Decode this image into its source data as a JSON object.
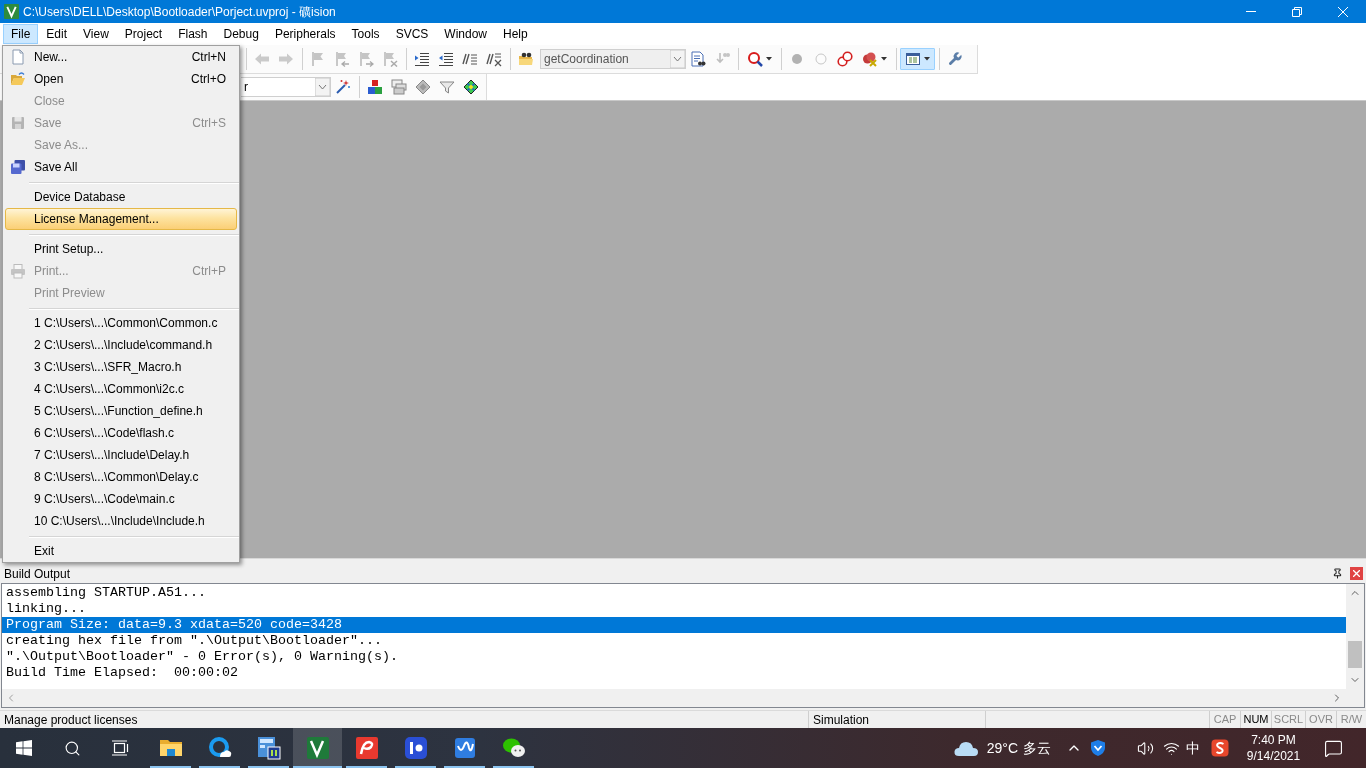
{
  "window": {
    "title": "C:\\Users\\DELL\\Desktop\\Bootloader\\Porject.uvproj - 礦ision"
  },
  "menu_bar": [
    {
      "label": "File",
      "selected": true
    },
    {
      "label": "Edit",
      "selected": false
    },
    {
      "label": "View",
      "selected": false
    },
    {
      "label": "Project",
      "selected": false
    },
    {
      "label": "Flash",
      "selected": false
    },
    {
      "label": "Debug",
      "selected": false
    },
    {
      "label": "Peripherals",
      "selected": false
    },
    {
      "label": "Tools",
      "selected": false
    },
    {
      "label": "SVCS",
      "selected": false
    },
    {
      "label": "Window",
      "selected": false
    },
    {
      "label": "Help",
      "selected": false
    }
  ],
  "toolbar_1": [
    {
      "kind": "separator"
    },
    {
      "kind": "button",
      "disabled": true,
      "pressed": false
    },
    {
      "kind": "button",
      "disabled": true,
      "pressed": false
    },
    {
      "kind": "separator"
    },
    {
      "kind": "button",
      "disabled": true,
      "pressed": false
    },
    {
      "kind": "button",
      "disabled": true,
      "pressed": false
    },
    {
      "kind": "button",
      "disabled": true,
      "pressed": false
    },
    {
      "kind": "button",
      "disabled": true,
      "pressed": false
    },
    {
      "kind": "separator"
    },
    {
      "kind": "button",
      "disabled": false,
      "pressed": false
    },
    {
      "kind": "button",
      "disabled": false,
      "pressed": false
    },
    {
      "kind": "button",
      "disabled": false,
      "pressed": false
    },
    {
      "kind": "button",
      "disabled": false,
      "pressed": false
    },
    {
      "kind": "separator"
    },
    {
      "kind": "button",
      "disabled": false,
      "pressed": false
    },
    {
      "kind": "combo",
      "value": "getCoordination",
      "disabled": true
    },
    {
      "kind": "button",
      "disabled": false,
      "pressed": false
    },
    {
      "kind": "button",
      "disabled": true,
      "pressed": false
    },
    {
      "kind": "separator"
    },
    {
      "kind": "split",
      "disabled": false,
      "pressed": false
    },
    {
      "kind": "separator"
    },
    {
      "kind": "button",
      "disabled": true,
      "pressed": false
    },
    {
      "kind": "button",
      "disabled": true,
      "pressed": false
    },
    {
      "kind": "button",
      "disabled": false,
      "pressed": false
    },
    {
      "kind": "split",
      "disabled": false,
      "pressed": false
    },
    {
      "kind": "separator"
    },
    {
      "kind": "split",
      "disabled": false,
      "pressed": true
    },
    {
      "kind": "separator"
    },
    {
      "kind": "button",
      "disabled": false,
      "pressed": false
    }
  ],
  "toolbar_2": [
    {
      "kind": "combo",
      "value": "r",
      "disabled": false
    },
    {
      "kind": "button"
    },
    {
      "kind": "separator"
    },
    {
      "kind": "button"
    },
    {
      "kind": "button"
    },
    {
      "kind": "button"
    },
    {
      "kind": "button"
    },
    {
      "kind": "button"
    }
  ],
  "file_menu": [
    {
      "kind": "item",
      "label": "New...",
      "shortcut": "Ctrl+N",
      "disabled": false,
      "selected": false
    },
    {
      "kind": "item",
      "label": "Open",
      "shortcut": "Ctrl+O",
      "disabled": false,
      "selected": false
    },
    {
      "kind": "item",
      "label": "Close",
      "disabled": true,
      "selected": false
    },
    {
      "kind": "item",
      "label": "Save",
      "shortcut": "Ctrl+S",
      "disabled": true,
      "selected": false
    },
    {
      "kind": "item",
      "label": "Save As...",
      "disabled": true,
      "selected": false
    },
    {
      "kind": "item",
      "label": "Save All",
      "disabled": false,
      "selected": false
    },
    {
      "kind": "separator"
    },
    {
      "kind": "item",
      "label": "Device Database",
      "disabled": false,
      "selected": false
    },
    {
      "kind": "item",
      "label": "License Management...",
      "disabled": false,
      "selected": true
    },
    {
      "kind": "separator"
    },
    {
      "kind": "item",
      "label": "Print Setup...",
      "disabled": false,
      "selected": false
    },
    {
      "kind": "item",
      "label": "Print...",
      "shortcut": "Ctrl+P",
      "disabled": true,
      "selected": false
    },
    {
      "kind": "item",
      "label": "Print Preview",
      "disabled": true,
      "selected": false
    },
    {
      "kind": "separator"
    },
    {
      "kind": "item",
      "label": "1 C:\\Users\\...\\Common\\Common.c",
      "disabled": false,
      "selected": false
    },
    {
      "kind": "item",
      "label": "2 C:\\Users\\...\\Include\\command.h",
      "disabled": false,
      "selected": false
    },
    {
      "kind": "item",
      "label": "3 C:\\Users\\...\\SFR_Macro.h",
      "disabled": false,
      "selected": false
    },
    {
      "kind": "item",
      "label": "4 C:\\Users\\...\\Common\\i2c.c",
      "disabled": false,
      "selected": false
    },
    {
      "kind": "item",
      "label": "5 C:\\Users\\...\\Function_define.h",
      "disabled": false,
      "selected": false
    },
    {
      "kind": "item",
      "label": "6 C:\\Users\\...\\Code\\flash.c",
      "disabled": false,
      "selected": false
    },
    {
      "kind": "item",
      "label": "7 C:\\Users\\...\\Include\\Delay.h",
      "disabled": false,
      "selected": false
    },
    {
      "kind": "item",
      "label": "8 C:\\Users\\...\\Common\\Delay.c",
      "disabled": false,
      "selected": false
    },
    {
      "kind": "item",
      "label": "9 C:\\Users\\...\\Code\\main.c",
      "disabled": false,
      "selected": false
    },
    {
      "kind": "item",
      "label": "10 C:\\Users\\...\\Include\\Include.h",
      "disabled": false,
      "selected": false
    },
    {
      "kind": "separator"
    },
    {
      "kind": "item",
      "label": "Exit",
      "disabled": false,
      "selected": false
    }
  ],
  "build_output": {
    "title": "Build Output",
    "lines": [
      {
        "text": "assembling STARTUP.A51...",
        "selected": false
      },
      {
        "text": "linking...",
        "selected": false
      },
      {
        "text": "Program Size: data=9.3 xdata=520 code=3428",
        "selected": true
      },
      {
        "text": "creating hex file from \".\\Output\\Bootloader\"...",
        "selected": false
      },
      {
        "text": "\".\\Output\\Bootloader\" - 0 Error(s), 0 Warning(s).",
        "selected": false
      },
      {
        "text": "Build Time Elapsed:  00:00:02",
        "selected": false
      }
    ]
  },
  "status_bar": {
    "message": "Manage product licenses",
    "mode": "Simulation",
    "indicators": [
      {
        "label": "CAP",
        "on": false
      },
      {
        "label": "NUM",
        "on": true
      },
      {
        "label": "SCRL",
        "on": false
      },
      {
        "label": "OVR",
        "on": false
      },
      {
        "label": "R/W",
        "on": false
      }
    ]
  },
  "taskbar": {
    "apps": [
      {
        "running": true,
        "active": false
      },
      {
        "running": true,
        "active": false
      },
      {
        "running": true,
        "active": false
      },
      {
        "running": true,
        "active": true
      },
      {
        "running": true,
        "active": false
      },
      {
        "running": true,
        "active": false
      },
      {
        "running": true,
        "active": false
      },
      {
        "running": true,
        "active": false
      }
    ],
    "weather": {
      "temperature": "29°C",
      "condition": "多云"
    },
    "input_method": "中",
    "time": "7:40 PM",
    "date": "9/14/2021"
  }
}
